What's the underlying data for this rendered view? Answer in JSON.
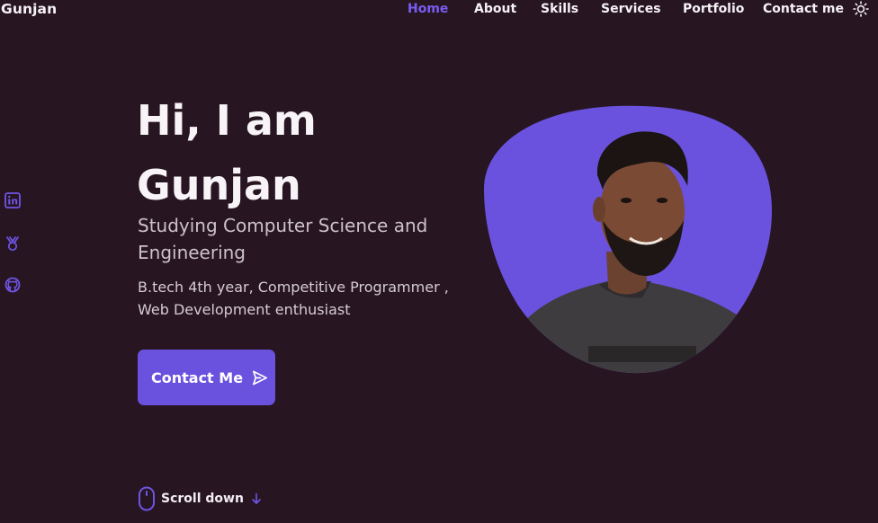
{
  "header": {
    "logo": "Gunjan",
    "nav": [
      {
        "label": "Home",
        "active": true
      },
      {
        "label": "About",
        "active": false
      },
      {
        "label": "Skills",
        "active": false
      },
      {
        "label": "Services",
        "active": false
      },
      {
        "label": "Portfolio",
        "active": false
      },
      {
        "label": "Contact me",
        "active": false
      }
    ],
    "theme_toggle_icon": "sun-icon"
  },
  "social": [
    {
      "icon": "linkedin-icon"
    },
    {
      "icon": "dribbble-icon"
    },
    {
      "icon": "github-icon"
    }
  ],
  "hero": {
    "title_line1": "Hi, I am",
    "title_line2": "Gunjan",
    "subtitle": "Studying Computer Science and Engineering",
    "description": "B.tech 4th year, Competitive Programmer , Web Development enthusiast",
    "contact_button": {
      "label": "Contact Me",
      "icon": "send-icon"
    },
    "scroll": {
      "label": "Scroll down",
      "icon": "mouse-icon",
      "arrow_icon": "arrow-down-icon"
    }
  },
  "colors": {
    "background": "#271522",
    "accent": "#6a52de",
    "nav_active": "#7a5cf2",
    "text": "#f3eef2",
    "subtitle_text": "#ccc2c9"
  }
}
